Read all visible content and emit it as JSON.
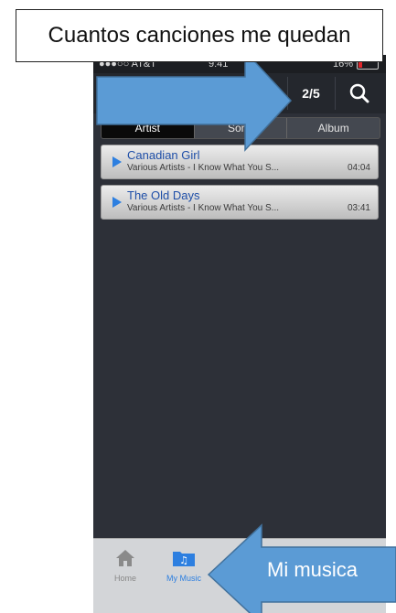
{
  "callouts": {
    "top": "Cuantos canciones me quedan",
    "bottom": "Mi musica"
  },
  "status": {
    "carrier": "●●●○○ AT&T",
    "time": "9:41",
    "battery": "16%"
  },
  "toolbar": {
    "counter": "2/5"
  },
  "segments": [
    "Artist",
    "Song",
    "Album"
  ],
  "songs": [
    {
      "title": "Canadian Girl",
      "subtitle": "Various Artists - I Know What You S...",
      "duration": "04:04"
    },
    {
      "title": "The Old Days",
      "subtitle": "Various Artists - I Know What You S...",
      "duration": "03:41"
    }
  ],
  "tabs": {
    "home": "Home",
    "my_music": "My Music"
  },
  "colors": {
    "accent": "#2d7fe0",
    "arrow": "#5b9bd5"
  }
}
